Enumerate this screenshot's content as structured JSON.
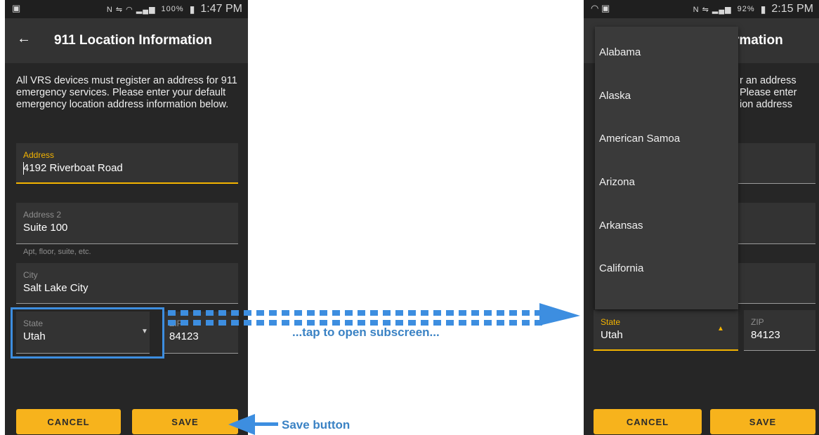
{
  "left_screen": {
    "status": {
      "time": "1:47 PM",
      "battery": "100%"
    },
    "title": "911 Location Information",
    "intro": "All VRS devices must register an address for 911 emergency services. Please enter your default emergency location address information below.",
    "address": {
      "label": "Address",
      "value": "4192 Riverboat Road"
    },
    "address2": {
      "label": "Address 2",
      "value": "Suite 100",
      "hint": "Apt, floor, suite, etc."
    },
    "city": {
      "label": "City",
      "value": "Salt Lake City"
    },
    "state": {
      "label": "State",
      "value": "Utah"
    },
    "zip": {
      "label": "ZIP",
      "value": "84123"
    },
    "buttons": {
      "cancel": "CANCEL",
      "save": "SAVE"
    }
  },
  "right_screen": {
    "status": {
      "time": "2:15 PM",
      "battery": "92%"
    },
    "title_fragment": "rmation",
    "intro_fragments": [
      "r an address",
      "Please enter",
      "ion address"
    ],
    "state_options": [
      "Alabama",
      "Alaska",
      "American Samoa",
      "Arizona",
      "Arkansas",
      "California"
    ],
    "state": {
      "label": "State",
      "value": "Utah"
    },
    "zip": {
      "label": "ZIP",
      "value": "84123"
    },
    "buttons": {
      "cancel": "CANCEL",
      "save": "SAVE"
    }
  },
  "annotations": {
    "tap": "...tap to open subscreen...",
    "save": "Save button"
  },
  "colors": {
    "accent": "#f4b400",
    "button": "#f7b31c",
    "callout": "#3a82c4",
    "screen_bg": "#262626"
  }
}
